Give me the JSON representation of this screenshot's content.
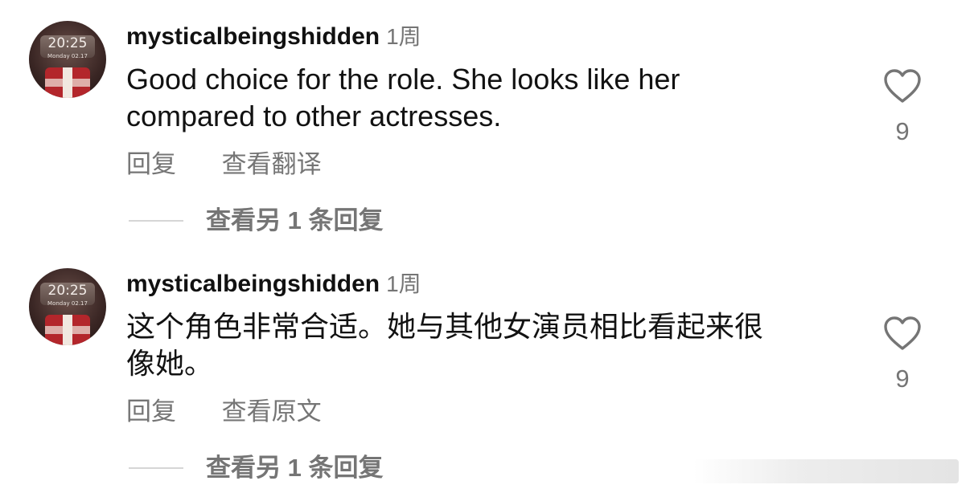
{
  "comments": [
    {
      "username": "mysticalbeingshidden",
      "age": "1周",
      "avatar": {
        "time": "20:25",
        "subtime": "Monday 02.17"
      },
      "text_line1": "Good choice for the role. She looks like her",
      "text_line2": "compared to other actresses.",
      "reply_label": "回复",
      "translate_label": "查看翻译",
      "view_replies_label": "查看另 1 条回复",
      "like_count": "9",
      "icon": "heart-outline-icon"
    },
    {
      "username": "mysticalbeingshidden",
      "age": "1周",
      "avatar": {
        "time": "20:25",
        "subtime": "Monday 02.17"
      },
      "text_line1": "这个角色非常合适。她与其他女演员相比看起来很",
      "text_line2": "像她。",
      "reply_label": "回复",
      "translate_label": "查看原文",
      "view_replies_label": "查看另 1 条回复",
      "like_count": "9",
      "icon": "heart-outline-icon"
    }
  ],
  "colors": {
    "text_primary": "#111111",
    "text_secondary": "#757575",
    "divider": "#d6d6d6",
    "heart_stroke": "#757575"
  }
}
